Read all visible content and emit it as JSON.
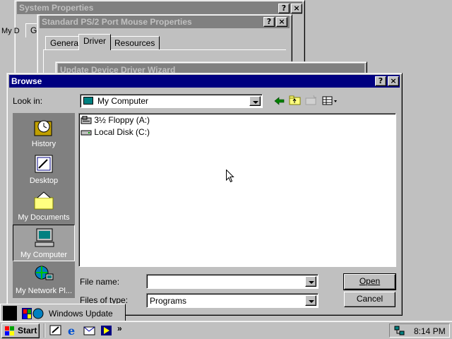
{
  "system_properties": {
    "title": "System Properties",
    "my_label": "My D",
    "tab": "Ge"
  },
  "mouse_properties": {
    "title": "Standard PS/2 Port Mouse Properties",
    "tabs": [
      "General",
      "Driver",
      "Resources"
    ],
    "selected_tab": "Driver"
  },
  "wizard": {
    "title": "Update Device Driver Wizard"
  },
  "browse": {
    "title": "Browse",
    "look_in_label": "Look in:",
    "look_in_value": "My Computer",
    "places": [
      {
        "label": "History",
        "icon": "history-icon"
      },
      {
        "label": "Desktop",
        "icon": "desktop-icon"
      },
      {
        "label": "My Documents",
        "icon": "my-documents-icon"
      },
      {
        "label": "My Computer",
        "icon": "my-computer-icon",
        "selected": true
      },
      {
        "label": "My Network Pl...",
        "icon": "network-icon"
      }
    ],
    "files": [
      {
        "label": "3½ Floppy (A:)",
        "icon": "floppy-drive-icon"
      },
      {
        "label": "Local Disk (C:)",
        "icon": "hard-disk-icon"
      }
    ],
    "file_name_label": "File name:",
    "file_name_value": "",
    "files_of_type_label": "Files of type:",
    "files_of_type_value": "Programs",
    "open_label": "Open",
    "cancel_label": "Cancel"
  },
  "popup": {
    "label": "Windows Update"
  },
  "taskbar": {
    "start_label": "Start",
    "chevron": "»",
    "clock": "8:14 PM"
  },
  "title_buttons": {
    "help": "?",
    "close": "×"
  }
}
